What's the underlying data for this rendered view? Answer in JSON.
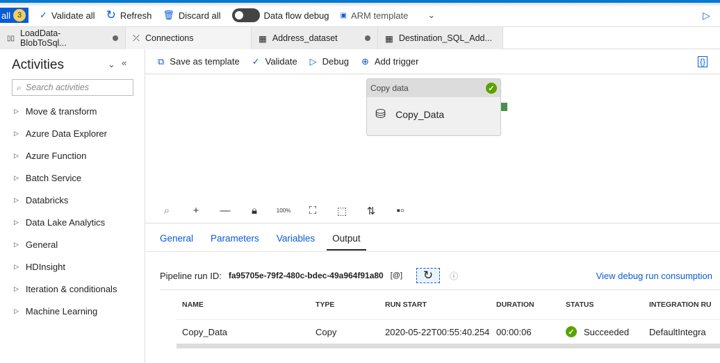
{
  "command_bar": {
    "publish_label": "all",
    "publish_count": "3",
    "validate_all": "Validate all",
    "refresh": "Refresh",
    "discard_all": "Discard all",
    "data_flow_debug": "Data flow debug",
    "data_flow_debug_on": false,
    "arm_template": "ARM template"
  },
  "tabs": [
    {
      "label": "LoadData-BlobToSql...",
      "icon": "pipeline-icon",
      "unsaved": true
    },
    {
      "label": "Connections",
      "icon": "connections-icon",
      "unsaved": false
    },
    {
      "label": "Address_dataset",
      "icon": "table-icon",
      "unsaved": true
    },
    {
      "label": "Destination_SQL_Add...",
      "icon": "table-icon",
      "unsaved": true
    }
  ],
  "sidebar": {
    "title": "Activities",
    "search_placeholder": "Search activities",
    "categories": [
      "Move & transform",
      "Azure Data Explorer",
      "Azure Function",
      "Batch Service",
      "Databricks",
      "Data Lake Analytics",
      "General",
      "HDInsight",
      "Iteration & conditionals",
      "Machine Learning"
    ]
  },
  "pipeline_toolbar": {
    "save_as_template": "Save as template",
    "validate": "Validate",
    "debug": "Debug",
    "add_trigger": "Add trigger"
  },
  "canvas": {
    "node": {
      "type": "Copy data",
      "name": "Copy_Data",
      "status": "succeeded"
    },
    "tools": [
      "search-icon",
      "zoom-in-icon",
      "zoom-out-icon",
      "lock-icon",
      "zoom-100-icon",
      "fit-icon",
      "select-icon",
      "auto-align-icon",
      "layout-icon"
    ],
    "zoom_100_label": "100%"
  },
  "panel": {
    "tabs": [
      "General",
      "Parameters",
      "Variables",
      "Output"
    ],
    "active_tab": "Output",
    "run_id_label": "Pipeline run ID:",
    "run_id": "fa95705e-79f2-480c-bdec-49a964f91a80",
    "copy_label": "[@]",
    "view_consumption": "View debug run consumption",
    "columns": [
      "NAME",
      "TYPE",
      "RUN START",
      "DURATION",
      "STATUS",
      "INTEGRATION RU"
    ],
    "rows": [
      {
        "name": "Copy_Data",
        "type": "Copy",
        "run_start": "2020-05-22T00:55:40.254",
        "duration": "00:00:06",
        "status": "Succeeded",
        "integration_runtime": "DefaultIntegra"
      }
    ]
  },
  "colors": {
    "accent": "#0a5bd7",
    "success": "#57a300"
  }
}
